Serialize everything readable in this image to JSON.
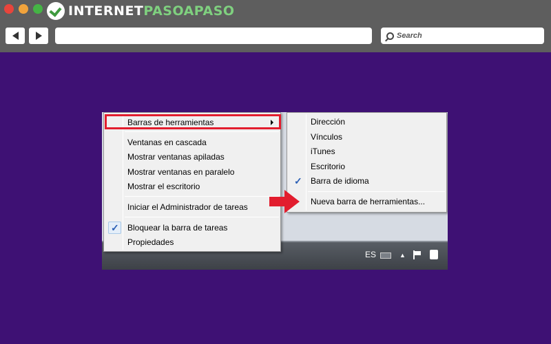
{
  "browser": {
    "logo_prefix": "INTERNET",
    "logo_accent": "PASOAPASO",
    "search_placeholder": "Search",
    "colors": {
      "background": "#3e1174",
      "chrome": "#5e5e5e",
      "highlight": "#e21d2e"
    }
  },
  "context_menu": {
    "items": [
      {
        "label": "Barras de herramientas",
        "has_submenu": true,
        "highlighted": true
      },
      {
        "label": "Ventanas en cascada"
      },
      {
        "label": "Mostrar ventanas apiladas"
      },
      {
        "label": "Mostrar ventanas en paralelo"
      },
      {
        "label": "Mostrar el escritorio"
      },
      {
        "label": "Iniciar el Administrador de tareas"
      },
      {
        "label": "Bloquear la barra de tareas",
        "checked": true
      },
      {
        "label": "Propiedades"
      }
    ]
  },
  "submenu": {
    "items": [
      {
        "label": "Dirección"
      },
      {
        "label": "Vínculos"
      },
      {
        "label": "iTunes"
      },
      {
        "label": "Escritorio"
      },
      {
        "label": "Barra de idioma",
        "checked": true
      },
      {
        "label": "Nueva barra de herramientas...",
        "pointed_by_arrow": true
      }
    ]
  },
  "taskbar": {
    "language": "ES",
    "check_glyph": "✓",
    "up_glyph": "▲"
  }
}
